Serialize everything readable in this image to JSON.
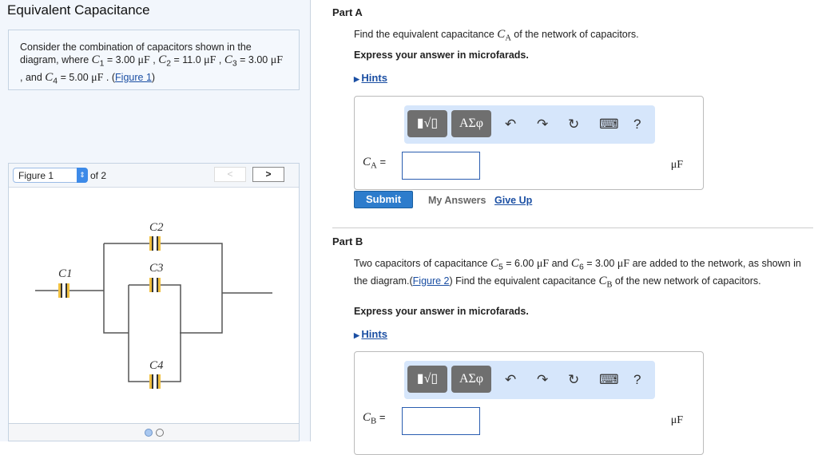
{
  "title": "Equivalent Capacitance",
  "intro": {
    "t1": "Consider the combination of capacitors shown in the diagram, where ",
    "c1": "C",
    "c1s": "1",
    "v1": " = 3.00 ",
    "uF": "μF",
    "sep": " , ",
    "c2": "C",
    "c2s": "2",
    "v2": " = 11.0 ",
    "c3": "C",
    "c3s": "3",
    "v3": " = 3.00 ",
    "and": " , and ",
    "c4": "C",
    "c4s": "4",
    "v4": " = 5.00 ",
    "end": " . (",
    "link": "Figure 1",
    "close": ")"
  },
  "figure": {
    "selected": "Figure 1",
    "of": "of 2",
    "prev": "<",
    "next": ">",
    "labels": [
      "C1",
      "C2",
      "C3",
      "C4"
    ],
    "page": 1,
    "pages": 2
  },
  "partA": {
    "heading": "Part A",
    "question": "Find the equivalent capacitance ",
    "sym": "C",
    "sub": "A",
    "q_end": " of the network of capacitors.",
    "express": "Express your answer in microfarads.",
    "hints": "Hints",
    "templates": "▮√▯",
    "greek": "ΑΣφ",
    "undo": "↶",
    "redo": "↷",
    "reset": "↻",
    "keyboard": "⌨",
    "help": "?",
    "eq": " =",
    "value": "",
    "unit": "μF",
    "submit": "Submit",
    "my_answers": "My Answers",
    "give_up": "Give Up"
  },
  "partB": {
    "heading": "Part B",
    "q1": "Two capacitors of capacitance ",
    "c5": "C",
    "c5s": "5",
    "v5": " = 6.00 ",
    "and": " and ",
    "c6": "C",
    "c6s": "6",
    "v6": " = 3.00 ",
    "q2": " are added to the network, as shown in the diagram.(",
    "link": "Figure 2",
    "q3": ") Find the equivalent capacitance ",
    "sym": "C",
    "sub": "B",
    "q4": " of the new network of capacitors.",
    "express": "Express your answer in microfarads.",
    "hints": "Hints",
    "templates": "▮√▯",
    "greek": "ΑΣφ",
    "undo": "↶",
    "redo": "↷",
    "reset": "↻",
    "keyboard": "⌨",
    "help": "?",
    "eq": " =",
    "value": "",
    "unit": "μF"
  }
}
